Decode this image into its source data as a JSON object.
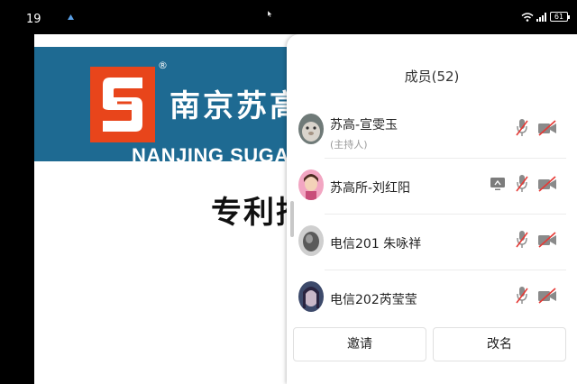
{
  "status_bar": {
    "time": "19",
    "battery_level": "61",
    "icons": [
      "app-glyph-icon",
      "wifi-icon",
      "signal-icon",
      "battery-icon"
    ]
  },
  "slide": {
    "company_name_cn": "南京苏高",
    "company_name_en": "NANJING SUGAO P",
    "registered_mark": "®",
    "heading": "专利挖",
    "colors": {
      "banner": "#1e6a92",
      "logo": "#e8451b"
    }
  },
  "members_panel": {
    "title": "成员(52)",
    "members": [
      {
        "name": "苏高-宣雯玉",
        "role": "(主持人)",
        "sharing": false,
        "mic": "muted",
        "camera": "off"
      },
      {
        "name": "苏高所-刘红阳",
        "role": "",
        "sharing": true,
        "mic": "muted",
        "camera": "off"
      },
      {
        "name": "电信201  朱咏祥",
        "role": "",
        "sharing": false,
        "mic": "muted",
        "camera": "off"
      },
      {
        "name": "电信202芮莹莹",
        "role": "",
        "sharing": false,
        "mic": "muted",
        "camera": "off"
      }
    ],
    "buttons": {
      "invite": "邀请",
      "rename": "改名"
    },
    "colors": {
      "muted_indicator": "#e53935",
      "icon_gray": "#8a8a8a"
    }
  }
}
